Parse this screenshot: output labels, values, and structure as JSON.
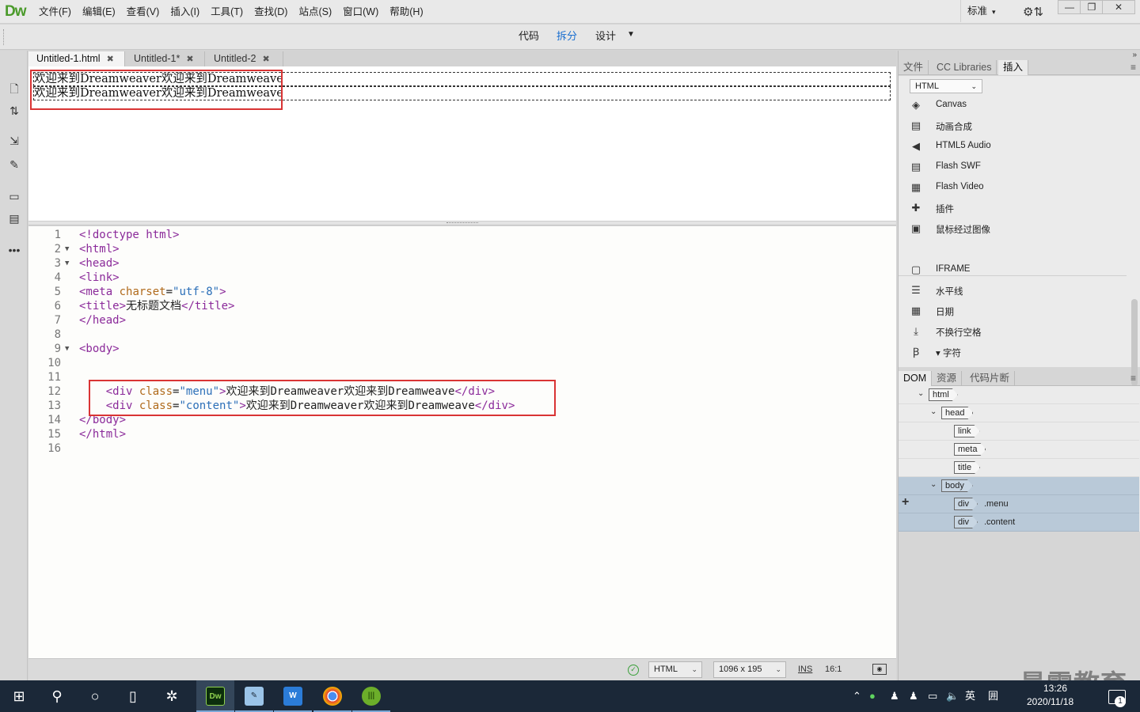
{
  "app": {
    "logo": "Dw",
    "menus": [
      "文件(F)",
      "编辑(E)",
      "查看(V)",
      "插入(I)",
      "工具(T)",
      "查找(D)",
      "站点(S)",
      "窗口(W)",
      "帮助(H)"
    ],
    "workspace": "标准",
    "window_buttons": {
      "minimize": "—",
      "restore": "❐",
      "close": "✕"
    }
  },
  "view_switch": {
    "code": "代码",
    "split": "拆分",
    "design": "设计",
    "active": "split"
  },
  "tabs": [
    {
      "label": "Untitled-1.html",
      "close": "✖",
      "active": true
    },
    {
      "label": "Untitled-1*",
      "close": "✖",
      "active": false
    },
    {
      "label": "Untitled-2",
      "close": "✖",
      "active": false
    }
  ],
  "design_view": {
    "lines": [
      "欢迎来到Dreamweaver欢迎来到Dreamweave",
      "欢迎来到Dreamweaver欢迎来到Dreamweave"
    ]
  },
  "code_view": {
    "lines": [
      {
        "n": "1",
        "fold": "",
        "html": "<!doctype html>"
      },
      {
        "n": "2",
        "fold": "▼",
        "html": "<html>"
      },
      {
        "n": "3",
        "fold": "▼",
        "html": "<head>"
      },
      {
        "n": "4",
        "fold": "",
        "html": "<link>"
      },
      {
        "n": "5",
        "fold": "",
        "html": "<meta charset=\"utf-8\">"
      },
      {
        "n": "6",
        "fold": "",
        "html": "<title>无标题文档</title>"
      },
      {
        "n": "7",
        "fold": "",
        "html": "</head>"
      },
      {
        "n": "8",
        "fold": "",
        "html": ""
      },
      {
        "n": "9",
        "fold": "▼",
        "html": "<body>"
      },
      {
        "n": "10",
        "fold": "",
        "html": ""
      },
      {
        "n": "11",
        "fold": "",
        "html": ""
      },
      {
        "n": "12",
        "fold": "",
        "html": "    <div class=\"menu\">欢迎来到Dreamweaver欢迎来到Dreamweave</div>"
      },
      {
        "n": "13",
        "fold": "",
        "html": "    <div class=\"content\">欢迎来到Dreamweaver欢迎来到Dreamweave</div>"
      },
      {
        "n": "14",
        "fold": "",
        "html": "</body>"
      },
      {
        "n": "15",
        "fold": "",
        "html": "</html>"
      },
      {
        "n": "16",
        "fold": "",
        "html": ""
      }
    ]
  },
  "status_bar": {
    "ok": "✓",
    "doc_type": "HTML",
    "size": "1096 x 195",
    "mode": "INS",
    "position": "16:1"
  },
  "right_panel": {
    "tabs": [
      {
        "label": "文件",
        "active": false
      },
      {
        "label": "CC Libraries",
        "active": false
      },
      {
        "label": "插入",
        "active": true
      }
    ],
    "insert_category": "HTML",
    "insert_items": [
      {
        "icon": "canvas-icon",
        "glyph": "◈",
        "label": "Canvas"
      },
      {
        "icon": "animation-icon",
        "glyph": "▤",
        "label": "动画合成"
      },
      {
        "icon": "audio-icon",
        "glyph": "◀",
        "label": "HTML5 Audio"
      },
      {
        "icon": "flash-swf-icon",
        "glyph": "▤",
        "label": "Flash SWF"
      },
      {
        "icon": "flash-video-icon",
        "glyph": "▦",
        "label": "Flash Video"
      },
      {
        "icon": "plugin-icon",
        "glyph": "✚",
        "label": "插件"
      },
      {
        "icon": "rollover-image-icon",
        "glyph": "▣",
        "label": "鼠标经过图像"
      },
      {
        "icon": "iframe-icon",
        "glyph": "▢",
        "label": "IFRAME"
      },
      {
        "icon": "horizontal-rule-icon",
        "glyph": "☰",
        "label": "水平线"
      },
      {
        "icon": "date-icon",
        "glyph": "▦",
        "label": "日期"
      },
      {
        "icon": "nbsp-icon",
        "glyph": "⤓",
        "label": "不换行空格"
      },
      {
        "icon": "character-icon",
        "glyph": "Ꞵ",
        "label": "▾ 字符"
      }
    ],
    "dom_tabs": [
      {
        "label": "DOM",
        "active": true
      },
      {
        "label": "资源",
        "active": false
      },
      {
        "label": "代码片断",
        "active": false
      }
    ],
    "dom_tree": [
      {
        "tag": "html",
        "cls": "",
        "depth": 0,
        "caret": "⌄",
        "selected": false
      },
      {
        "tag": "head",
        "cls": "",
        "depth": 1,
        "caret": "⌄",
        "selected": false
      },
      {
        "tag": "link",
        "cls": "",
        "depth": 2,
        "caret": "",
        "selected": false
      },
      {
        "tag": "meta",
        "cls": "",
        "depth": 2,
        "caret": "",
        "selected": false
      },
      {
        "tag": "title",
        "cls": "",
        "depth": 2,
        "caret": "",
        "selected": false
      },
      {
        "tag": "body",
        "cls": "",
        "depth": 1,
        "caret": "⌄",
        "selected": true
      },
      {
        "tag": "div",
        "cls": ".menu",
        "depth": 2,
        "caret": "",
        "selected": true
      },
      {
        "tag": "div",
        "cls": ".content",
        "depth": 2,
        "caret": "",
        "selected": true
      }
    ]
  },
  "taskbar": {
    "apps": [
      "Dw",
      "W"
    ],
    "tray_lang": "英",
    "tray_ime": "囲",
    "clock_time": "13:26",
    "clock_date": "2020/11/18",
    "notification_count": "1",
    "watermark": "最需教育"
  },
  "colors": {
    "accent": "#1a6fd0",
    "highlight_red": "#d93434",
    "tag_purple": "#8b2a9a",
    "attr_orange": "#b06a1b",
    "string_blue": "#2b6fb8",
    "dom_selected": "#b9c9d8",
    "dw_green": "#4a9a2a"
  }
}
